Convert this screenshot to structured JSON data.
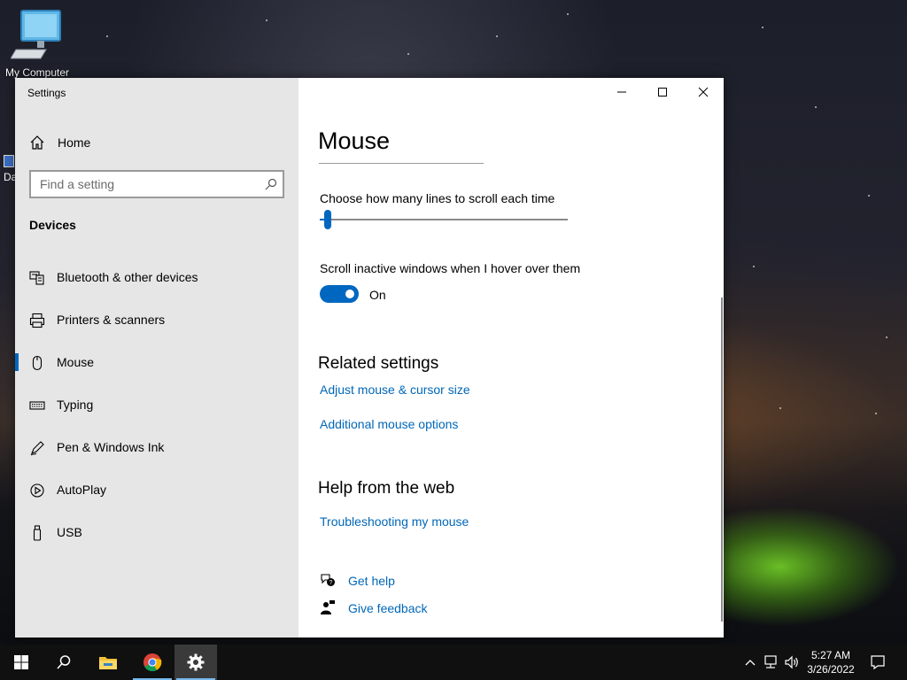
{
  "desktop": {
    "icon_label": "My Computer",
    "icon2_label": "Da"
  },
  "window": {
    "app_title": "Settings",
    "controls": {
      "minimize": "minimize-icon",
      "maximize": "maximize-icon",
      "close": "close-icon"
    }
  },
  "sidebar": {
    "home_label": "Home",
    "search_placeholder": "Find a setting",
    "section_title": "Devices",
    "items": [
      {
        "label": "Bluetooth & other devices",
        "icon": "bluetooth-devices-icon"
      },
      {
        "label": "Printers & scanners",
        "icon": "printer-icon"
      },
      {
        "label": "Mouse",
        "icon": "mouse-icon",
        "active": true
      },
      {
        "label": "Typing",
        "icon": "keyboard-icon"
      },
      {
        "label": "Pen & Windows Ink",
        "icon": "pen-icon"
      },
      {
        "label": "AutoPlay",
        "icon": "autoplay-icon"
      },
      {
        "label": "USB",
        "icon": "usb-icon"
      }
    ]
  },
  "main": {
    "title": "Mouse",
    "scroll_lines_label": "Choose how many lines to scroll each time",
    "scroll_lines_value": 3,
    "scroll_lines_range": [
      1,
      100
    ],
    "inactive_scroll_label": "Scroll inactive windows when I hover over them",
    "inactive_scroll_state": "On",
    "related_title": "Related settings",
    "related_links": [
      "Adjust mouse & cursor size",
      "Additional mouse options"
    ],
    "help_title": "Help from the web",
    "help_links": [
      "Troubleshooting my mouse"
    ],
    "get_help": "Get help",
    "give_feedback": "Give feedback"
  },
  "taskbar": {
    "time": "5:27 AM",
    "date": "3/26/2022",
    "accent": "#0067c0"
  }
}
